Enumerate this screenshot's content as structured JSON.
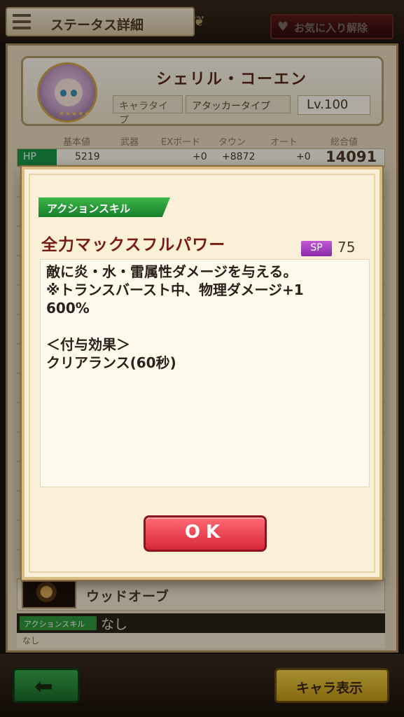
{
  "header": {
    "title": "ステータス詳細",
    "favorite_label": "お気に入り解除"
  },
  "character": {
    "name": "シェリル・コーエン",
    "type_label": "キャラタイプ",
    "type_value": "アタッカータイプ",
    "level": "Lv.100",
    "stars": "★★★★★"
  },
  "stats": {
    "headers": [
      "基本値",
      "武器",
      "EXボード",
      "タウン",
      "オート",
      "総合値"
    ],
    "hp": {
      "label": "HP",
      "base": "5219",
      "exboard": "+0",
      "town": "+8872",
      "auto": "+0",
      "total": "14091"
    }
  },
  "equipment": {
    "name": "ウッドオーブ",
    "skill_label": "アクションスキル",
    "skill_value": "なし",
    "skill_sub": "なし"
  },
  "footer": {
    "chara_button": "キャラ表示"
  },
  "modal": {
    "skill_type": "アクションスキル",
    "skill_name": "全力マックスフルパワー",
    "sp_label": "SP",
    "sp_value": "75",
    "description": "敵に炎・水・雷属性ダメージを与える。\n※トランスバースト中、物理ダメージ+1\n600%\n\n＜付与効果＞\nクリアランス(60秒)",
    "ok_label": "OK"
  },
  "colors": {
    "accent_red": "#d8283a",
    "skill_green": "#16802a",
    "sp_purple": "#8a2aa8",
    "skill_name_color": "#7a1a14"
  }
}
